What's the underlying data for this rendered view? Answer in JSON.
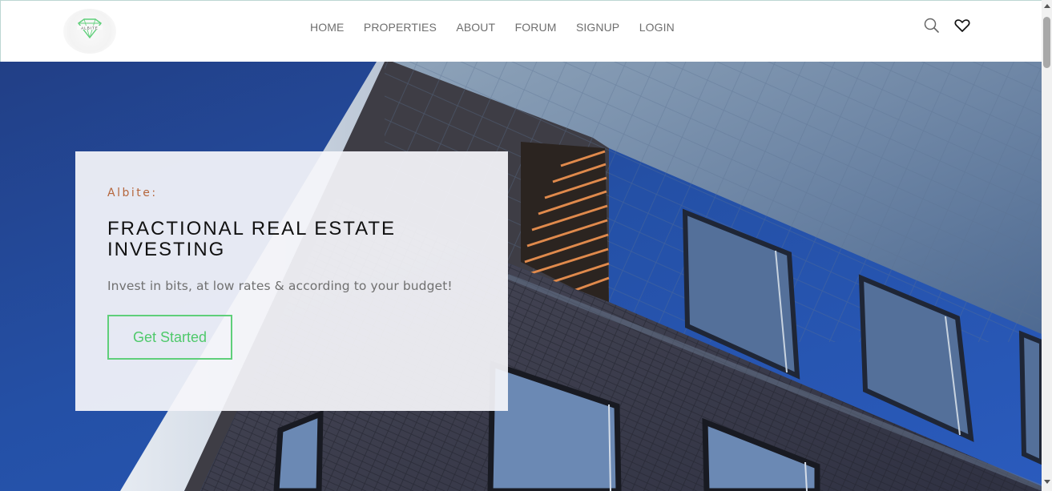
{
  "header": {
    "logo_text": "ALBITE",
    "nav": [
      {
        "label": "HOME"
      },
      {
        "label": "PROPERTIES"
      },
      {
        "label": "ABOUT"
      },
      {
        "label": "FORUM"
      },
      {
        "label": "SIGNUP"
      },
      {
        "label": "LOGIN"
      }
    ],
    "icons": [
      "search-icon",
      "heart-icon"
    ]
  },
  "hero": {
    "eyebrow": "Albite:",
    "title": "FRACTIONAL REAL ESTATE INVESTING",
    "subtitle": "Invest in bits, at low rates & according to your budget!",
    "cta_label": "Get Started"
  },
  "colors": {
    "accent_green": "#4fc96b",
    "eyebrow_brown": "#b5663c",
    "sky_blue": "#2450a6"
  }
}
